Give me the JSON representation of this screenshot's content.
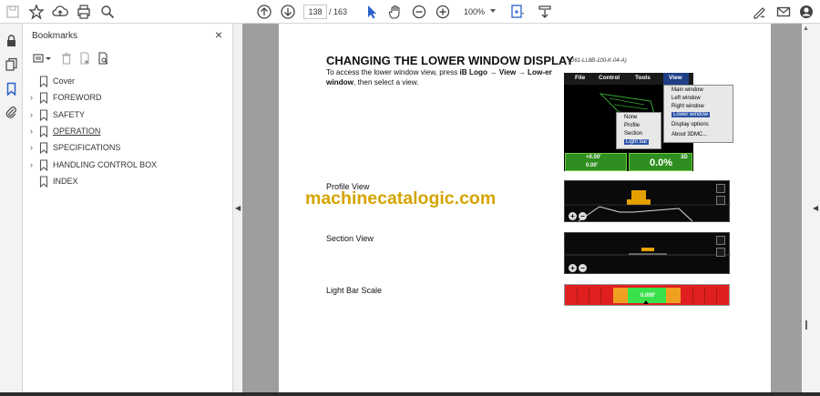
{
  "toolbar": {
    "page_current": "138",
    "page_total": "/ 163",
    "zoom": "100%",
    "icons": [
      "save-icon",
      "star-icon",
      "cloud-upload-icon",
      "print-icon",
      "zoom-search-icon",
      "page-up-icon",
      "page-down-icon",
      "select-pointer-icon",
      "hand-icon",
      "zoom-out-icon",
      "zoom-in-icon",
      "fit-page-icon",
      "scroll-mode-icon",
      "sign-icon",
      "email-icon",
      "account-icon"
    ]
  },
  "left_rail": {
    "icons": [
      "lock-icon",
      "pages-icon",
      "bookmark-icon",
      "attachment-icon"
    ]
  },
  "bookmarks_panel": {
    "title": "Bookmarks",
    "close_label": "×",
    "items": [
      {
        "label": "Cover",
        "expandable": false
      },
      {
        "label": "FOREWORD",
        "expandable": true
      },
      {
        "label": "SAFETY",
        "expandable": true
      },
      {
        "label": "OPERATION",
        "expandable": true
      },
      {
        "label": "SPECIFICATIONS",
        "expandable": true
      },
      {
        "label": "HANDLING CONTROL BOX",
        "expandable": true
      },
      {
        "label": "INDEX",
        "expandable": false
      }
    ]
  },
  "document": {
    "heading": "CHANGING THE LOWER WINDOW DISPLAY",
    "heading_code": "(D61-LL8B-100-K-04-A)",
    "intro_1": "To access the lower window view, press ",
    "intro_2": "iB Logo",
    "intro_3": " → ",
    "intro_4": "View",
    "intro_5": " → ",
    "intro_6": "Low-er window",
    "intro_7": ", then select a view.",
    "profile_label": "Profile View",
    "section_label": "Section View",
    "lightbar_label": "Light Bar Scale",
    "watermark": "machinecatalogic.com",
    "screen_menu": [
      "File",
      "Control",
      "Tools",
      "View"
    ],
    "view_menu": [
      "Main window",
      "Left window",
      "Right window",
      "Lower window",
      "Display options",
      "About 3DMC..."
    ],
    "lower_submenu": [
      "None",
      "Profile",
      "Section",
      "Light bar"
    ],
    "hud_left_top": "+0.00'",
    "hud_left_bottom": "0.00'",
    "hud_right_value": "0.0%",
    "hud_right_tag": "3D",
    "lightbar_value": "0.000'"
  }
}
